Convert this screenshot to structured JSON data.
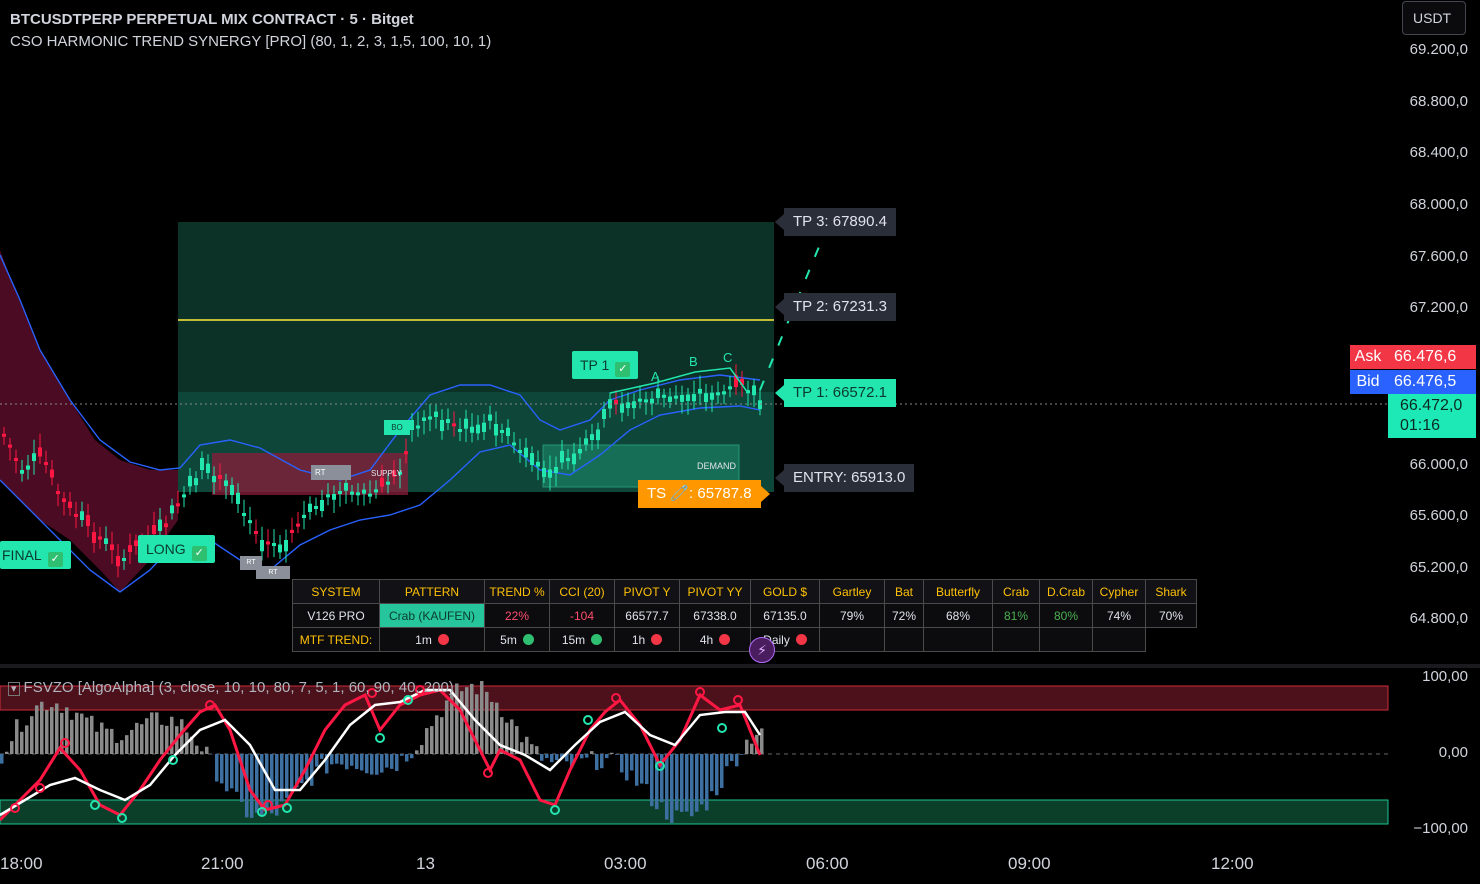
{
  "header": {
    "title": "BTCUSDTPERP PERPETUAL MIX CONTRACT · 5 · Bitget",
    "indicator": "CSO HARMONIC TREND SYNERGY [PRO] (80, 1, 2, 3, 1,5, 100, 10, 1)"
  },
  "currency": "USDT",
  "price_axis": [
    "69.200,0",
    "68.800,0",
    "68.400,0",
    "68.000,0",
    "67.600,0",
    "67.200,0",
    "66.000,0",
    "65.600,0",
    "65.200,0",
    "64.800,0"
  ],
  "ask": {
    "label": "Ask",
    "value": "66.476,6",
    "color": "#f23645"
  },
  "bid": {
    "label": "Bid",
    "value": "66.476,5",
    "color": "#2962ff"
  },
  "last": {
    "price": "66.472,0",
    "countdown": "01:16"
  },
  "targets": {
    "tp3": "TP 3: 67890.4",
    "tp2": "TP 2: 67231.3",
    "tp1": "TP 1: 66572.1",
    "entry": "ENTRY: 65913.0",
    "ts": "TS 🧷: 65787.8"
  },
  "labels": {
    "tp1_hit": "TP 1",
    "final": "FINAL",
    "long": "LONG",
    "a": "A",
    "b": "B",
    "c": "C",
    "demand": "DEMAND",
    "supply": "SUPPLY",
    "bo": "BO",
    "rt": "RT"
  },
  "stats_table": {
    "headers": [
      "SYSTEM",
      "PATTERN",
      "TREND %",
      "CCI (20)",
      "PIVOT Y",
      "PIVOT YY",
      "GOLD $",
      "Gartley",
      "Bat",
      "Butterfly",
      "Crab",
      "D.Crab",
      "Cypher",
      "Shark"
    ],
    "row": [
      "V126 PRO",
      "Crab (KAUFEN)",
      "22%",
      "-104",
      "66577.7",
      "67338.0",
      "67135.0",
      "79%",
      "72%",
      "68%",
      "81%",
      "80%",
      "74%",
      "70%"
    ],
    "mtf_label": "MTF TREND:",
    "mtf": [
      "1m",
      "5m",
      "15m",
      "1h",
      "4h",
      "Daily"
    ]
  },
  "oscillator": {
    "title": "FSVZO [AlgoAlpha] (3, close, 10, 10, 80, 7, 5, 1, 60, 90, 40, 200)",
    "axis": [
      "100,00",
      "0,00",
      "−100,00"
    ]
  },
  "time_axis": [
    "18:00",
    "21:00",
    "13",
    "03:00",
    "06:00",
    "09:00",
    "12:00"
  ],
  "colors": {
    "bull": "#22e6ae",
    "bear": "#ff1744",
    "band": "#2962ff",
    "accent": "#ffeb3b"
  }
}
